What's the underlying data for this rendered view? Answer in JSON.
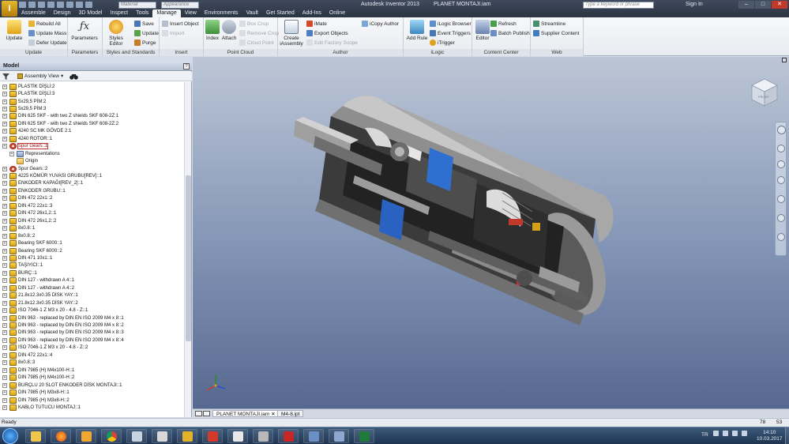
{
  "titlebar": {
    "material_placeholder": "Material",
    "appearance_placeholder": "Appearance",
    "app_name": "Autodesk Inventor 2013",
    "doc_name": "PLANET MONTAJI.iam",
    "search_placeholder": "Type a keyword or phrase",
    "sign_in": "Sign In",
    "logo_letter": "I"
  },
  "menu_tabs": [
    "Assemble",
    "Design",
    "3D Model",
    "Inspect",
    "Tools",
    "Manage",
    "View",
    "Environments",
    "Vault",
    "Get Started",
    "Add-Ins",
    "Online"
  ],
  "ribbon": {
    "update": {
      "title": "Update",
      "big": "Update",
      "rebuild_all": "Rebuild All",
      "update_mass": "Update Mass",
      "defer_update": "Defer Update"
    },
    "parameters": {
      "title": "Parameters",
      "big": "Parameters"
    },
    "styles": {
      "title": "Styles and Standards",
      "big": "Styles Editor",
      "save": "Save",
      "update": "Update",
      "purge": "Purge"
    },
    "insert": {
      "title": "Insert",
      "insert_object": "Insert Object",
      "import": "Import"
    },
    "point_cloud": {
      "title": "Point Cloud",
      "index": "Index",
      "attach": "Attach",
      "box_crop": "Box Crop",
      "remove_crop": "Remove Crop",
      "cloud_point": "Cloud Point"
    },
    "author": {
      "title": "Author",
      "create": "Create iAssembly",
      "imate": "iMate",
      "export_objects": "Export Objects",
      "edit_factory": "Edit Factory Scope",
      "icopy": "iCopy Author"
    },
    "ilogic": {
      "title": "iLogic",
      "add_rule": "Add Rule",
      "browser": "iLogic Browser",
      "event_triggers": "Event Triggers",
      "itrigger": "iTrigger"
    },
    "content_center": {
      "title": "Content Center",
      "editor": "Editor",
      "refresh": "Refresh",
      "batch_publish": "Batch Publish"
    },
    "web": {
      "title": "Web",
      "streamline": "Streamline",
      "supplier_content": "Supplier Content"
    }
  },
  "browser": {
    "title": "Model",
    "view_mode": "Assembly View",
    "help": "?",
    "items": [
      "PLASTİK DİŞLİ:2",
      "PLASTİK DİŞLİ:3",
      "5x29,5 PİM:2",
      "5x29,5 PİM:3",
      "DIN 625 SKF - with two Z shields SKF 608-2Z:1",
      "DIN 625 SKF - with two Z shields SKF 608-2Z:2",
      "4240 SC MK GÖVDE 2:1",
      "4240 ROTOR::1",
      "Spur Gears::1",
      "Representations",
      "Origin",
      "Spur Gears::2",
      "4225 KÖMÜR YUVASI GRUBU[REV]::1",
      "ENKODER KAPAĞI[REV_2]::1",
      "ENKODER GRUBU::1",
      "DIN 472 22x1::2",
      "DIN 472 22x1::3",
      "DIN 472 26x1,2::1",
      "DIN 472 26x1,2::2",
      "8x0.8::1",
      "8x0.8::2",
      "Bearing SKF 6000::1",
      "Bearing SKF 6000::2",
      "DIN 471 10x1::1",
      "TAŞIYICI::1",
      "BURÇ::1",
      "DIN 127 - withdrawn A 4::1",
      "DIN 127 - withdrawn A 4::2",
      "21.8x12.3x0.35 DİSK YAY::1",
      "21.8x12.3x0.35 DİSK YAY::2",
      "ISO 7046-1  Z M3 x 20 - 4.8 - Z::1",
      "DIN 963 - replaced by DIN EN ISO 2009 M4 x 8::1",
      "DIN 963 - replaced by DIN EN ISO 2009 M4 x 8::2",
      "DIN 963 - replaced by DIN EN ISO 2009 M4 x 8::3",
      "DIN 963 - replaced by DIN EN ISO 2009 M4 x 8::4",
      "ISO 7046-1  Z M3 x 20 - 4.8 - Z::2",
      "DIN 472 22x1::4",
      "8x0.8::3",
      "DIN 7985 (H) M4x100-H::1",
      "DIN 7985 (H) M4x100-H::2",
      "BURÇLU 20 SLOT ENKODER DİSK MONTAJI::1",
      "DIN 7985 (H) M3x8-H::1",
      "DIN 7985 (H) M3x8-H::2",
      "KABLO TUTUCU MONTAJ::1"
    ]
  },
  "viewcube_label": "FRONT",
  "doc_tabs": [
    "PLANET MONTAJI.iam",
    "M4-8.ipt"
  ],
  "status": {
    "text": "Ready",
    "num1": "78",
    "num2": "53"
  },
  "taskbar": {
    "lang": "TR",
    "time": "14:10",
    "date": "10.03.2017"
  }
}
